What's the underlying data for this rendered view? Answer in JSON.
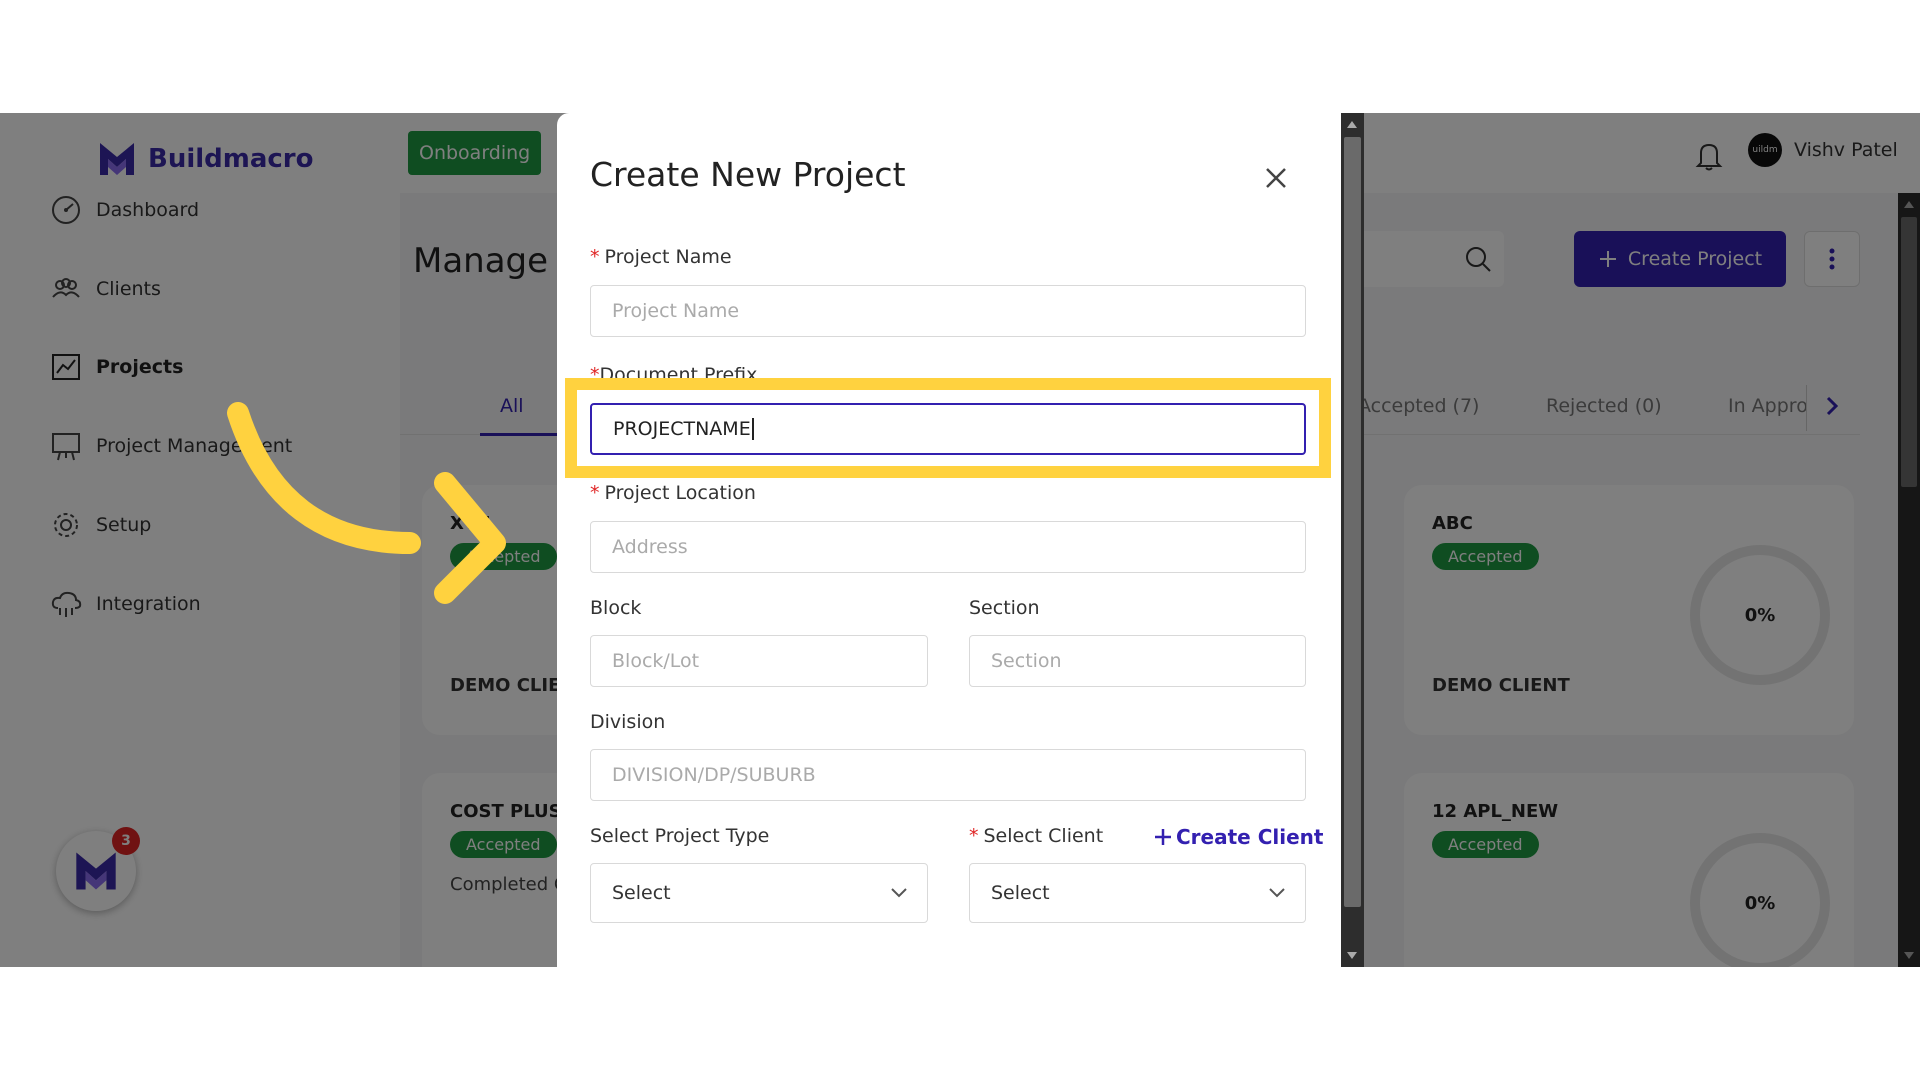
{
  "app": {
    "brand": "Buildmacro",
    "onboarding_label": "Onboarding",
    "user_name": "Vishv Patel",
    "user_avatar_text": "uildm",
    "fab_badge_count": "3"
  },
  "sidebar": {
    "items": [
      {
        "label": "Dashboard",
        "icon": "dashboard-icon"
      },
      {
        "label": "Clients",
        "icon": "clients-icon"
      },
      {
        "label": "Projects",
        "icon": "projects-icon",
        "active": true
      },
      {
        "label": "Project Management",
        "icon": "project-management-icon"
      },
      {
        "label": "Setup",
        "icon": "gear-icon"
      },
      {
        "label": "Integration",
        "icon": "cloud-integration-icon"
      }
    ]
  },
  "main": {
    "page_title": "Manage P",
    "create_project_label": "Create Project",
    "tabs": [
      {
        "label": "All",
        "active": true
      },
      {
        "label": "Accepted (7)"
      },
      {
        "label": "Rejected (0)"
      },
      {
        "label": "In Appro"
      }
    ],
    "cards": [
      {
        "title": "XYZ",
        "status": "Accepted",
        "client": "DEMO CLIE"
      },
      {
        "title": "ABC",
        "status": "Accepted",
        "client": "DEMO CLIENT",
        "progress": "0%"
      },
      {
        "title": "COST PLUS",
        "status": "Accepted",
        "description": "Completed Client of co of construc"
      },
      {
        "title": "12 APL_NEW",
        "status": "Accepted",
        "progress": "0%"
      }
    ]
  },
  "modal": {
    "title": "Create New Project",
    "fields": {
      "project_name": {
        "label": "Project Name",
        "placeholder": "Project Name",
        "required": true
      },
      "document_prefix": {
        "label": "Document Prefix",
        "value": "PROJECTNAME",
        "required": true
      },
      "project_location": {
        "label": "Project Location",
        "placeholder": "Address",
        "required": true
      },
      "block": {
        "label": "Block",
        "placeholder": "Block/Lot"
      },
      "section": {
        "label": "Section",
        "placeholder": "Section"
      },
      "division": {
        "label": "Division",
        "placeholder": "DIVISION/DP/SUBURB"
      },
      "project_type": {
        "label": "Select Project Type",
        "value": "Select"
      },
      "client": {
        "label": "Select Client",
        "value": "Select",
        "required": true
      }
    },
    "create_client_label": "Create Client"
  },
  "colors": {
    "brand": "#3320b0",
    "success": "#1f9a42",
    "highlight": "#ffd23f",
    "required": "#e02525"
  }
}
